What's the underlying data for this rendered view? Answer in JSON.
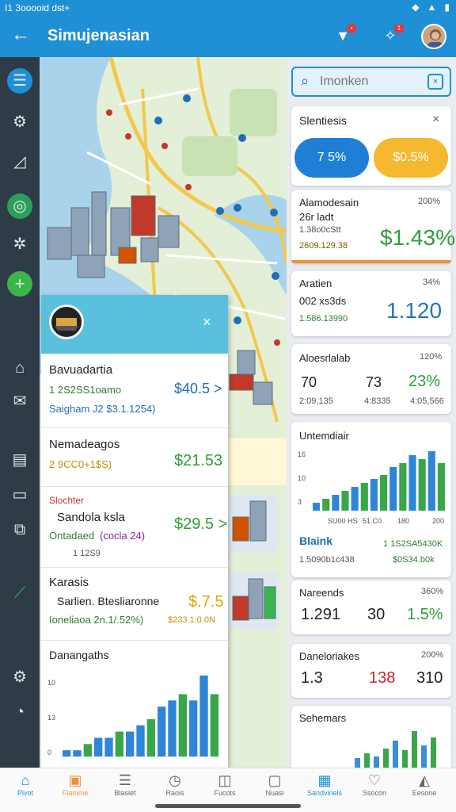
{
  "status_bar": {
    "left_text": "I1 3ooooid dst+",
    "icons": [
      "wifi-icon",
      "signal-icon",
      "battery-icon"
    ]
  },
  "app_bar": {
    "title": "Simujenasian",
    "back_icon": "arrow-left-icon",
    "notif_badge_1": "",
    "notif_badge_2": "1"
  },
  "search": {
    "placeholder": "Imonken"
  },
  "filter_card": {
    "title": "Slentiesis",
    "pill_blue": "7 5%",
    "pill_yellow": "$0.5%"
  },
  "stat_cards": [
    {
      "title": "Alamodesain",
      "corner": "200%",
      "line1": "26r ladt",
      "line2": "1.38o0cStt",
      "line3": "2609.129.38",
      "value": "$1.43%",
      "value_color": "#2e9e3a"
    },
    {
      "title": "Aratien",
      "corner": "34%",
      "line1": "002 xs3ds",
      "line2": "1.586.13990",
      "value": "1.120",
      "value_color": "#1f76c4"
    },
    {
      "title": "Aloesrlalab",
      "corner": "120%",
      "col1": "70",
      "col2": "73",
      "col3": "23%",
      "sub1": "2:09,135",
      "sub2": "4:8335",
      "sub3": "4:05,566"
    }
  ],
  "chart_card": {
    "title": "Untemdiair",
    "y_ticks": [
      "16",
      "10",
      "3"
    ],
    "x_labels": [
      "SU00 HS",
      "51.C0",
      "180",
      "200"
    ],
    "footer_title": "Blaink",
    "footer_right1": "1 1S2SA5430K",
    "footer_left": "1.5090b1c438",
    "footer_right2": "$0S34.b0k"
  },
  "chart_data": {
    "type": "bar",
    "title": "Untemdiair",
    "series": [
      {
        "values": [
          2,
          3,
          4,
          5,
          6,
          7,
          8,
          9,
          11,
          12,
          14,
          13,
          15,
          12
        ]
      }
    ],
    "ylim": [
      0,
      16
    ]
  },
  "metric_cards": [
    {
      "title": "Nareends",
      "corner": "360%",
      "v1": "1.291",
      "v2": "30",
      "v3": "1.5%"
    },
    {
      "title": "Daneloriakes",
      "corner": "200%",
      "v1": "1.3",
      "v2": "138",
      "v3": "310"
    },
    {
      "title": "Sehemars"
    }
  ],
  "list_panel": {
    "items": [
      {
        "title": "Bavuadartia",
        "line1": "1 2S2SS1oamo",
        "line2": "Saigham J2 $3.1.1254)",
        "price": "$40.5 >"
      },
      {
        "title": "Nemadeagos",
        "line1": "2 9CC0+1$S)",
        "price": "$21.53"
      },
      {
        "tag": "Slochter",
        "title": "Sandola ksla",
        "line1": "Ontadaed",
        "line1b": "(cocla 24)",
        "line2": "1 12S9",
        "price": "$29.5 >"
      },
      {
        "title": "Karasis",
        "subtitle": "Sarlien. Btesliaronne",
        "line1": "Ioneliaoa 2n.1/.52%)",
        "line2": "$233.1:0.0N",
        "price": "$.7.5"
      },
      {
        "title": "Danangaths",
        "y_ticks": [
          "10",
          "13",
          "0"
        ]
      }
    ]
  },
  "list_chart_data": {
    "type": "bar",
    "title": "Danangaths",
    "series": [
      {
        "values": [
          1,
          1,
          2,
          3,
          3,
          4,
          4,
          5,
          6,
          8,
          9,
          10,
          9,
          13,
          10
        ]
      }
    ]
  },
  "bottom_nav": [
    {
      "label": "Pivot",
      "icon": "home-icon",
      "active": true
    },
    {
      "label": "Flamme",
      "icon": "image-icon"
    },
    {
      "label": "Blasiet",
      "icon": "list-icon"
    },
    {
      "label": "Raois",
      "icon": "clock-icon"
    },
    {
      "label": "Fucots",
      "icon": "bag-icon"
    },
    {
      "label": "Nuasi",
      "icon": "box-icon"
    },
    {
      "label": "Sandvinels",
      "icon": "calendar-icon",
      "active": true
    },
    {
      "label": "Ssocon",
      "icon": "heart-icon"
    },
    {
      "label": "Eesone",
      "icon": "profile-icon"
    }
  ]
}
